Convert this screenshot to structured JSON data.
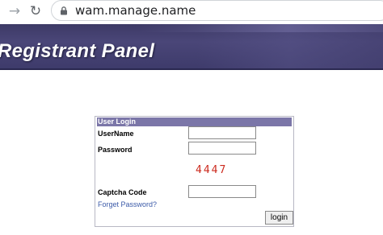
{
  "browser": {
    "url": "wam.manage.name",
    "forward_icon": "arrow-right-icon",
    "reload_icon": "reload-icon",
    "lock_icon": "lock-icon"
  },
  "banner": {
    "title": "Registrant Panel",
    "colors": {
      "background": "#46427a",
      "text": "#ffffff"
    }
  },
  "login": {
    "header": "User Login",
    "username_label": "UserName",
    "username_value": "",
    "password_label": "Password",
    "password_value": "",
    "captcha_text": "4447",
    "captcha_label": "Captcha Code",
    "captcha_value": "",
    "forgot_link": "Forget Password?",
    "button_label": "login",
    "colors": {
      "header": "#7b76a8",
      "captcha": "#cc2a1e",
      "link": "#3b5aa8"
    }
  }
}
